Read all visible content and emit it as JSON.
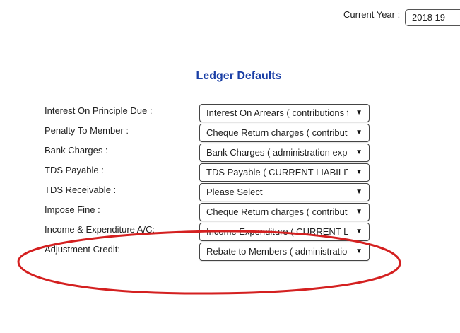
{
  "header": {
    "current_year_label": "Current Year :",
    "current_year_value": "2018 19"
  },
  "page_title": "Ledger Defaults",
  "rows": [
    {
      "label": "Interest On Principle Due :",
      "selected": "Interest On Arrears ( contributions fr"
    },
    {
      "label": "Penalty To Member :",
      "selected": "Cheque Return charges ( contributio"
    },
    {
      "label": "Bank Charges :",
      "selected": "Bank Charges ( administration expe"
    },
    {
      "label": "TDS Payable :",
      "selected": "TDS Payable ( CURRENT LIABILIT"
    },
    {
      "label": "TDS Receivable :",
      "selected": "Please Select"
    },
    {
      "label": "Impose Fine :",
      "selected": "Cheque Return charges ( contributio"
    },
    {
      "label": "Income & Expenditure A/C:",
      "selected": "Income Expenditure ( CURRENT LI"
    },
    {
      "label": "Adjustment Credit:",
      "selected": "Rebate to Members ( administration"
    }
  ],
  "icons": {
    "dropdown_arrow": "▼"
  },
  "colors": {
    "title": "#1a3fa6",
    "annotation_ellipse": "#d42020"
  }
}
